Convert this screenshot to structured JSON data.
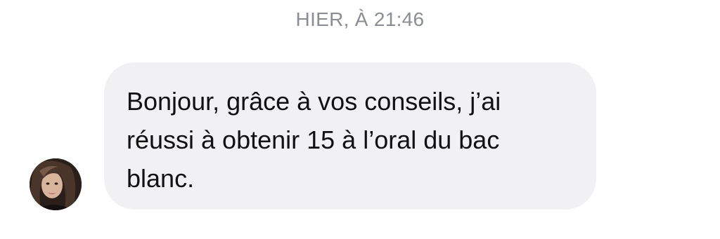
{
  "conversation": {
    "timestamp": "HIER, À 21:46",
    "messages": [
      {
        "direction": "incoming",
        "text": "Bonjour, grâce à vos conseils, j’ai\nréussi à obtenir 15 à l’oral du bac\nblanc.",
        "avatar_icon": "user-avatar-photo"
      }
    ]
  }
}
